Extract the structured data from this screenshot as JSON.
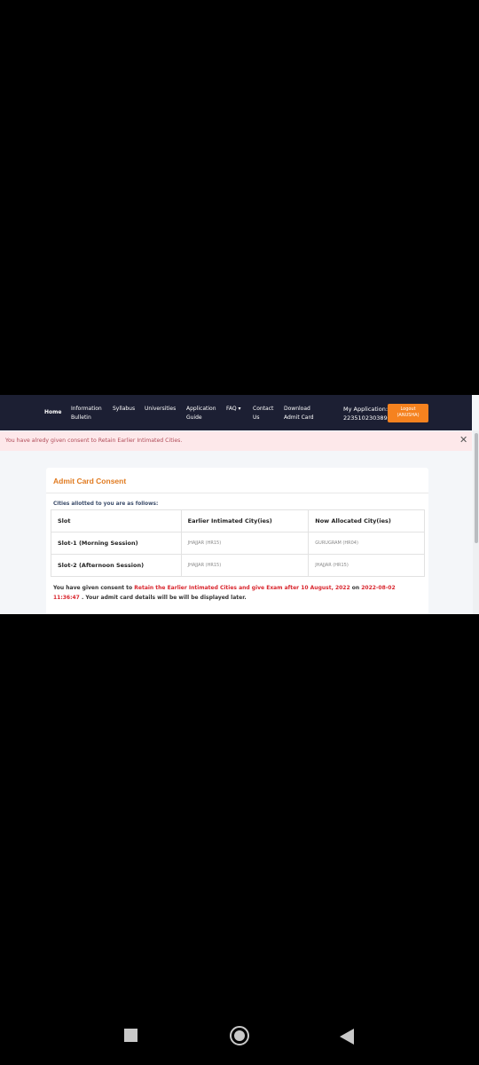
{
  "nav": {
    "home": "Home",
    "information_bulletin": "Information\nBulletin",
    "syllabus": "Syllabus",
    "universities": "Universities",
    "application_guide": "Application\nGuide",
    "faq": "FAQ ▾",
    "contact_us": "Contact\nUs",
    "download_admit_card": "Download\nAdmit Card",
    "my_application_label": "My Application:",
    "application_number": "223510230389",
    "logout_label": "Logout\n(ANUSHA)"
  },
  "alert": {
    "text": "You have alredy given consent to Retain Earlier Intimated Cities.",
    "close": "✕"
  },
  "card": {
    "title": "Admit Card Consent",
    "note": "Cities allotted to you are as follows:",
    "table": {
      "headers": [
        "Slot",
        "Earlier Intimated City(ies)",
        "Now Allocated City(ies)"
      ],
      "rows": [
        [
          "Slot-1 (Morning Session)",
          "JHAJJAR (HR15)",
          "GURUGRAM (HR04)"
        ],
        [
          "Slot-2 (Afternoon Session)",
          "JHAJJAR (HR15)",
          "JHAJJAR (HR15)"
        ]
      ]
    },
    "consent": {
      "prefix": "You have given consent to ",
      "highlight": "Retain the Earlier Intimated Cities and give Exam after 10 August, 2022",
      "middle": " on ",
      "timestamp": "2022-08-02 11:36:47",
      "suffix": " . Your admit card details will be will be displayed later."
    }
  }
}
